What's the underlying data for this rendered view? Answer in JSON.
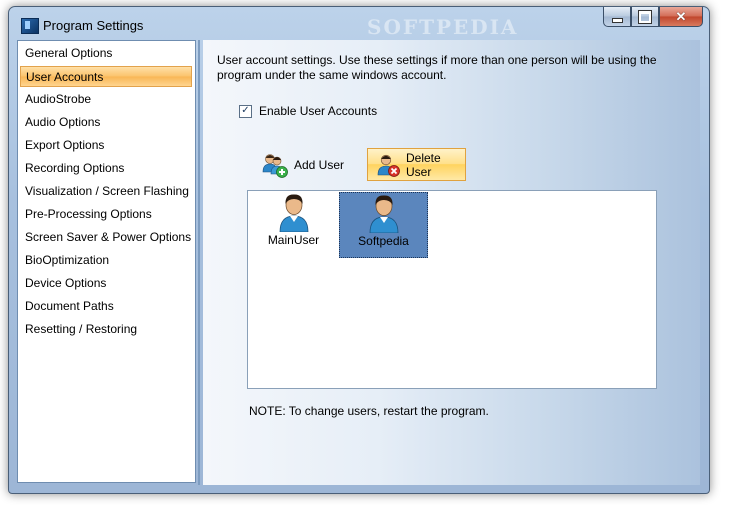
{
  "window": {
    "title": "Program Settings",
    "watermark": "SOFTPEDIA"
  },
  "sidebar": {
    "items": [
      {
        "label": "General Options",
        "active": false
      },
      {
        "label": "User Accounts",
        "active": true
      },
      {
        "label": "AudioStrobe",
        "active": false
      },
      {
        "label": "Audio Options",
        "active": false
      },
      {
        "label": "Export Options",
        "active": false
      },
      {
        "label": "Recording Options",
        "active": false
      },
      {
        "label": "Visualization / Screen Flashing",
        "active": false
      },
      {
        "label": "Pre-Processing Options",
        "active": false
      },
      {
        "label": "Screen Saver & Power Options",
        "active": false
      },
      {
        "label": "BioOptimization",
        "active": false
      },
      {
        "label": "Device Options",
        "active": false
      },
      {
        "label": "Document Paths",
        "active": false
      },
      {
        "label": "Resetting / Restoring",
        "active": false
      }
    ]
  },
  "main": {
    "description": "User account settings. Use these settings if more than one person will be using the program under the same windows account.",
    "enable_label": "Enable User Accounts",
    "enable_checked": true,
    "add_user_label": "Add User",
    "delete_user_label": "Delete User",
    "users": [
      {
        "name": "MainUser",
        "selected": false
      },
      {
        "name": "Softpedia",
        "selected": true
      }
    ],
    "note": "NOTE: To change users, restart the program."
  },
  "icons": {
    "add": "user-add-icon",
    "delete": "user-delete-icon",
    "user": "user-avatar-icon"
  },
  "colors": {
    "active_nav": "#fbc36b",
    "selection": "#5b86bd"
  }
}
